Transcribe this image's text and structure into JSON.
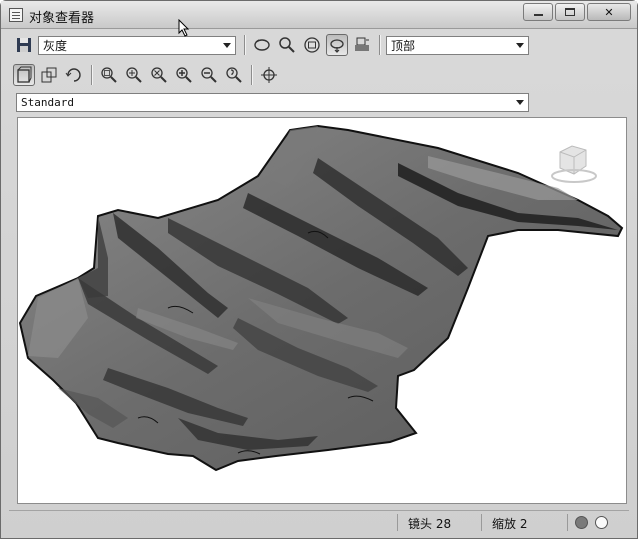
{
  "window": {
    "title": "对象查看器"
  },
  "toolbar_top": {
    "visual_style_value": "灰度",
    "view_direction_value": "顶部",
    "icons": [
      "save-icon",
      "orbit-icon",
      "zoom-icon",
      "zoom-fit-icon",
      "pan-icon",
      "print-icon"
    ]
  },
  "toolbar_second": {
    "icons": [
      "view-cube-icon",
      "copy-view-icon",
      "refresh-icon",
      "zoom-window-icon",
      "zoom-realtime-icon",
      "zoom-extents-icon",
      "zoom-in-icon",
      "zoom-out-icon",
      "zoom-previous-icon",
      "crosshair-icon"
    ]
  },
  "named_view": {
    "value": "Standard"
  },
  "status": {
    "lens_label": "镜头",
    "lens_value": "28",
    "zoom_label": "缩放",
    "zoom_value": "2"
  },
  "colors": {
    "terrain_fill": "#6a6a6a",
    "terrain_dark": "#2e2e2e",
    "chrome": "#d2d2d2"
  }
}
